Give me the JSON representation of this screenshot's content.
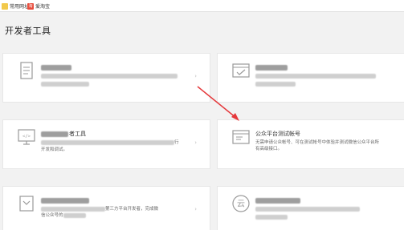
{
  "bookmarks": [
    {
      "label": "常用网址",
      "icon": "folder-icon"
    },
    {
      "label": "爱淘宝",
      "icon": "taobao-icon"
    }
  ],
  "page_title": "开发者工具",
  "cards": [
    {
      "title_visible": "",
      "desc_visible": [
        "",
        ""
      ],
      "icon": "document-icon"
    },
    {
      "title_visible": "",
      "desc_visible": [
        "",
        ""
      ],
      "icon": "browser-check-icon"
    },
    {
      "title_visible": "者工具",
      "desc_visible": [
        "行",
        "开发和调试。"
      ],
      "icon": "code-monitor-icon"
    },
    {
      "title_visible": "公众平台测试帐号",
      "desc_visible": [
        "无需申请公众帐号、可在测试帐号中体验并测试微信公众平台所",
        "有高级接口。"
      ],
      "icon": "test-account-icon"
    },
    {
      "title_visible": "",
      "desc_visible": [
        "第三方平台开发者，完成微",
        "信公众号的"
      ],
      "icon": "third-party-icon"
    },
    {
      "title_visible": "",
      "desc_visible": [
        "",
        ""
      ],
      "icon": "cloud-icon"
    }
  ],
  "colors": {
    "accent_green": "#44b549",
    "arrow_red": "#e5383b"
  }
}
